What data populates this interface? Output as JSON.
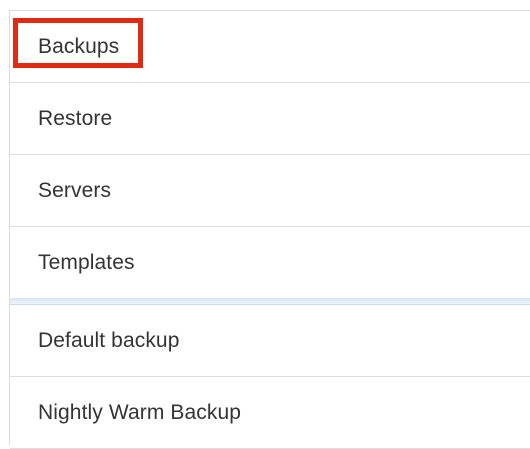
{
  "menu": {
    "primary_items": [
      {
        "label": "Backups",
        "highlighted": true
      },
      {
        "label": "Restore"
      },
      {
        "label": "Servers"
      },
      {
        "label": "Templates"
      }
    ],
    "secondary_items": [
      {
        "label": "Default backup"
      },
      {
        "label": "Nightly Warm Backup"
      }
    ]
  },
  "colors": {
    "highlight": "#e02b13",
    "text": "#333333",
    "divider": "#dedede",
    "section_divider": "#d6e6f3"
  }
}
